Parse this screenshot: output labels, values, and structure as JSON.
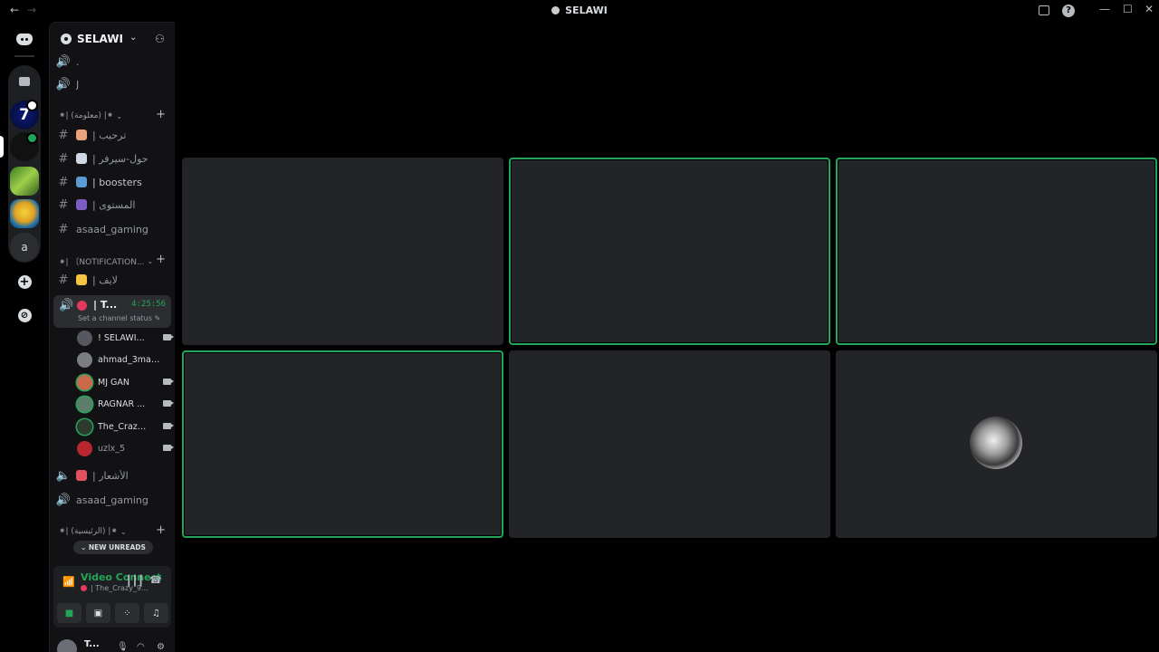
{
  "titlebar": {
    "back": "←",
    "forward": "→",
    "title": "SELAWI",
    "help": "?",
    "minimize": "—",
    "maximize": "☐",
    "close": "✕"
  },
  "rail": {
    "server_7_label": "7",
    "server_a_label": "a",
    "add_server": "+",
    "discover": "⊘"
  },
  "server": {
    "name": "SELAWI",
    "chevron": "⌄",
    "invite": "⚇"
  },
  "channels_top": [
    {
      "icon": "🔊",
      "label": "."
    },
    {
      "icon": "🔊",
      "label": "J"
    }
  ],
  "category_info": {
    "label": "⁕| (معلومة) |⁕",
    "chevron": "⌄",
    "plus": "+"
  },
  "info_channels": [
    {
      "icon": "#",
      "label": "| ترحيب",
      "emoji_color": "#e8a27c"
    },
    {
      "icon": "#",
      "label": "| حول-سيرفر",
      "emoji_color": "#cfd8e3"
    },
    {
      "icon": "#",
      "label": "| boosters",
      "emoji_color": "#5b9bd5"
    },
    {
      "icon": "#",
      "label": "| المستوى",
      "emoji_color": "#7d5cc4"
    },
    {
      "icon": "#",
      "label": "asaad_gaming",
      "emoji_color": ""
    }
  ],
  "category_notif": {
    "label": "⁕| 〔NOTIFICATION...",
    "chevron": "⌄",
    "plus": "+"
  },
  "notif_channels": [
    {
      "icon": "#",
      "label": "| لايف",
      "emoji_color": "#f5c542"
    }
  ],
  "voice_active": {
    "icon": "🔊",
    "name": "| T...",
    "timer": "4:25:56",
    "status": "Set a channel status ✎"
  },
  "members": [
    {
      "name": "! SELAWI...",
      "avatar_color": "#55585e",
      "speaking": false
    },
    {
      "name": "ahmad_3marya",
      "avatar_color": "#7a7d82",
      "speaking": false
    },
    {
      "name": "MJ GAN",
      "avatar_color": "#c96a4a",
      "speaking": true
    },
    {
      "name": "RAGNAR ...",
      "avatar_color": "#5e7d6a",
      "speaking": true
    },
    {
      "name": "The_Crazy...",
      "avatar_color": "#2f3a2f",
      "speaking": true
    },
    {
      "name": "uzlx_5",
      "avatar_color": "#b8262f",
      "speaking": false
    }
  ],
  "voice_channels": [
    {
      "icon": "🔈",
      "label": "| الأشعار",
      "emoji_color": "#e0525e"
    },
    {
      "icon": "🔊",
      "label": "asaad_gaming",
      "emoji_color": ""
    }
  ],
  "category_main": {
    "label": "⁕| (الرئيسية) |⁕",
    "chevron": "⌄",
    "plus": "+"
  },
  "new_unreads": "⌄ NEW UNREADS",
  "voice_panel": {
    "title": "Video Connect",
    "subtitle": "| The_Crazy_9...",
    "signal_icon": "📶",
    "noise_icon": "┃┃┃",
    "disconnect_icon": "☎",
    "camera": "■",
    "screen": "▣",
    "activity": "⁘",
    "soundboard": "♫"
  },
  "user_panel": {
    "username": "T...",
    "mic": "🎙",
    "headset": "◠",
    "settings": "⚙"
  },
  "tiles": [
    {
      "speaking": false,
      "has_avatar": false
    },
    {
      "speaking": true,
      "has_avatar": false
    },
    {
      "speaking": true,
      "has_avatar": false
    },
    {
      "speaking": true,
      "has_avatar": false
    },
    {
      "speaking": false,
      "has_avatar": false
    },
    {
      "speaking": false,
      "has_avatar": true
    }
  ],
  "colors": {
    "accent_green": "#23a559",
    "live_red": "#e5385e",
    "tile_bg": "#232428"
  }
}
